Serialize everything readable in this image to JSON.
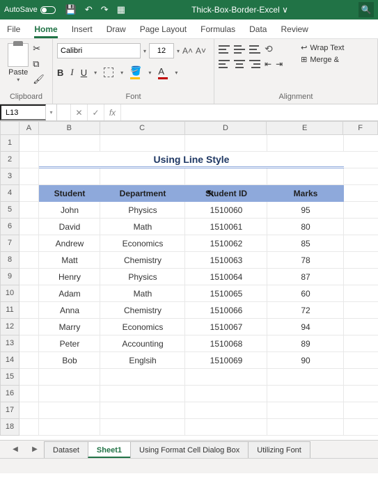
{
  "titlebar": {
    "autosave": "AutoSave",
    "filename": "Thick-Box-Border-Excel ∨"
  },
  "menu": {
    "file": "File",
    "home": "Home",
    "insert": "Insert",
    "draw": "Draw",
    "pagelayout": "Page Layout",
    "formulas": "Formulas",
    "data": "Data",
    "review": "Review"
  },
  "ribbon": {
    "clipboard": {
      "label": "Clipboard",
      "paste": "Paste"
    },
    "font": {
      "label": "Font",
      "name": "Calibri",
      "size": "12",
      "bold": "B",
      "italic": "I",
      "underline": "U",
      "bigA": "A˄",
      "smallA": "A˅"
    },
    "align": {
      "label": "Alignment",
      "wrap": "Wrap Text",
      "merge": "Merge &"
    }
  },
  "formulabar": {
    "name": "L13",
    "cancel": "✕",
    "enter": "✓",
    "fx": "fx",
    "value": ""
  },
  "columns": [
    "A",
    "B",
    "C",
    "D",
    "E",
    "F"
  ],
  "rows": [
    "1",
    "2",
    "3",
    "4",
    "5",
    "6",
    "7",
    "8",
    "9",
    "10",
    "11",
    "12",
    "13",
    "14",
    "15",
    "16",
    "17",
    "18"
  ],
  "sheet": {
    "title": "Using Line Style",
    "headers": {
      "b": "Student",
      "c": "Department",
      "d": "Student ID",
      "e": "Marks"
    },
    "data": [
      {
        "b": "John",
        "c": "Physics",
        "d": "1510060",
        "e": "95"
      },
      {
        "b": "David",
        "c": "Math",
        "d": "1510061",
        "e": "80"
      },
      {
        "b": "Andrew",
        "c": "Economics",
        "d": "1510062",
        "e": "85"
      },
      {
        "b": "Matt",
        "c": "Chemistry",
        "d": "1510063",
        "e": "78"
      },
      {
        "b": "Henry",
        "c": "Physics",
        "d": "1510064",
        "e": "87"
      },
      {
        "b": "Adam",
        "c": "Math",
        "d": "1510065",
        "e": "60"
      },
      {
        "b": "Anna",
        "c": "Chemistry",
        "d": "1510066",
        "e": "72"
      },
      {
        "b": "Marry",
        "c": "Economics",
        "d": "1510067",
        "e": "94"
      },
      {
        "b": "Peter",
        "c": "Accounting",
        "d": "1510068",
        "e": "89"
      },
      {
        "b": "Bob",
        "c": "Englsih",
        "d": "1510069",
        "e": "90"
      }
    ]
  },
  "sheettabs": {
    "dataset": "Dataset",
    "sheet1": "Sheet1",
    "fmt": "Using Format Cell Dialog Box",
    "font": "Utilizing Font"
  }
}
